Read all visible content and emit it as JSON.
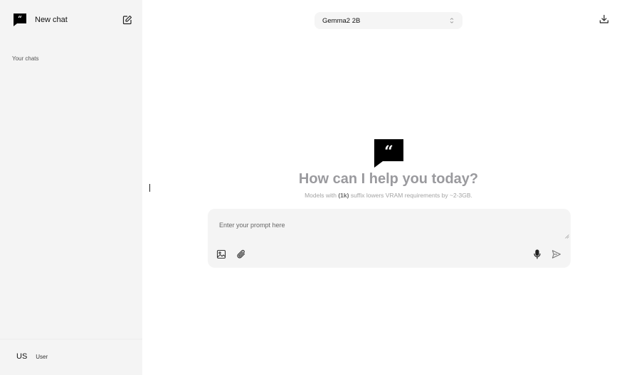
{
  "sidebar": {
    "new_chat_label": "New chat",
    "section_label": "Your chats",
    "user": {
      "initials": "US",
      "name": "User"
    }
  },
  "header": {
    "model_selected": "Gemma2 2B"
  },
  "hero": {
    "title": "How can I help you today?",
    "subtitle_before": "Models with ",
    "subtitle_highlight": "(1k)",
    "subtitle_after": " suffix lowers VRAM requirements by ~2-3GB."
  },
  "prompt": {
    "placeholder": "Enter your prompt here",
    "value": ""
  },
  "icons": {
    "logo": "quote-bubble-icon",
    "edit": "edit-icon",
    "chevron": "chevron-updown-icon",
    "download": "download-icon",
    "image": "image-icon",
    "attach": "paperclip-icon",
    "mic": "microphone-icon",
    "send": "send-icon"
  },
  "colors": {
    "sidebar_bg": "#f4f4f4",
    "input_bg": "#f4f4f4",
    "title_gray": "#9a9a9e",
    "logo_black": "#000000"
  }
}
